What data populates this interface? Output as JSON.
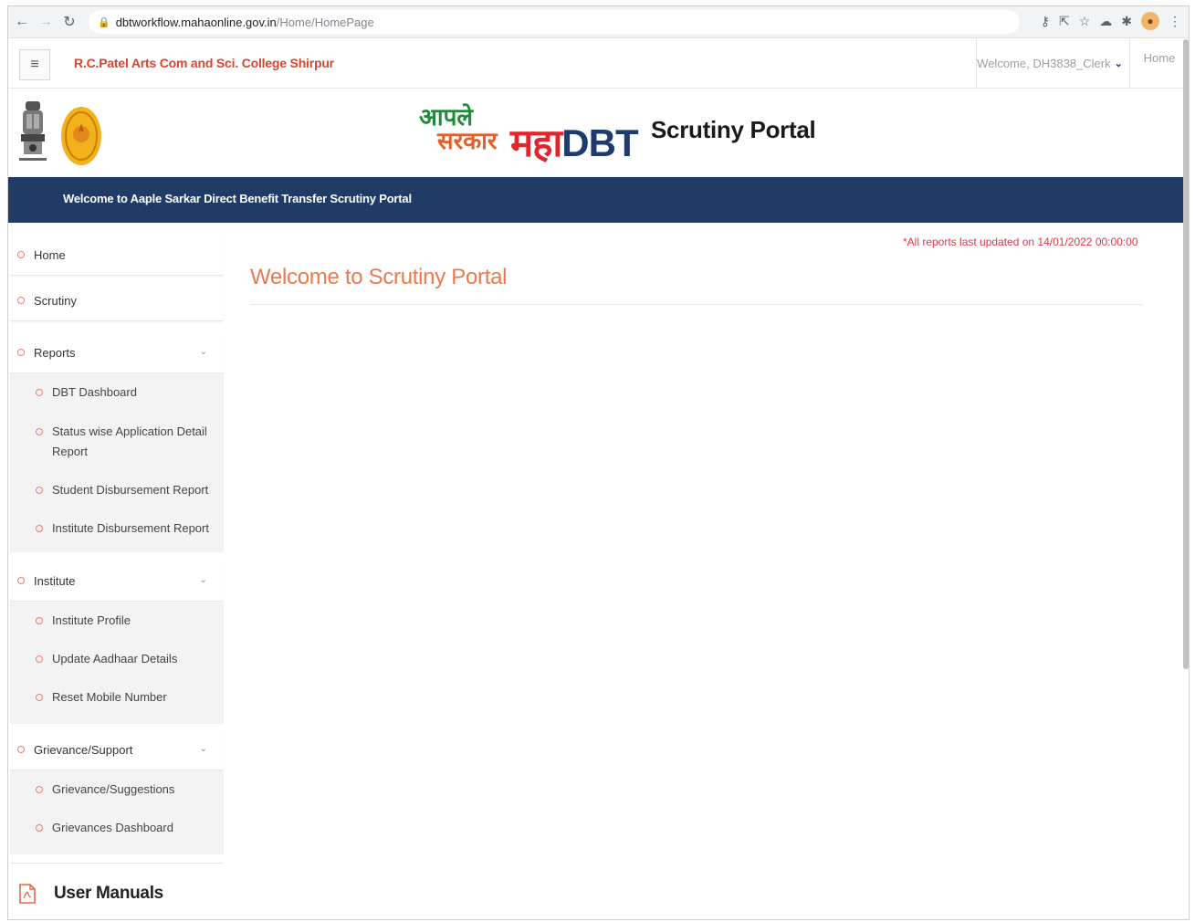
{
  "browser": {
    "url_host": "dbtworkflow.mahaonline.gov.in",
    "url_path": "/Home/HomePage"
  },
  "header": {
    "college_name": "R.C.Patel Arts Com and Sci. College Shirpur",
    "welcome_user": "Welcome, DH3838_Clerk",
    "home_link": "Home"
  },
  "logos": {
    "aaple_line1": "आपले",
    "aaple_line2": "सरकार",
    "maha_prefix": "महा",
    "maha_dbt": "DBT",
    "portal_title": "Scrutiny Portal"
  },
  "banner": {
    "text": "Welcome to Aaple Sarkar Direct Benefit Transfer Scrutiny Portal"
  },
  "sidebar": {
    "home": "Home",
    "scrutiny": "Scrutiny",
    "reports": {
      "label": "Reports",
      "items": [
        "DBT Dashboard",
        "Status wise Application Detail Report",
        "Student Disbursement Report",
        "Institute Disbursement Report"
      ]
    },
    "institute": {
      "label": "Institute",
      "items": [
        "Institute Profile",
        "Update Aadhaar Details",
        "Reset Mobile Number"
      ]
    },
    "grievance": {
      "label": "Grievance/Support",
      "items": [
        "Grievance/Suggestions",
        "Grievances Dashboard"
      ]
    },
    "user_manuals": "User Manuals"
  },
  "main": {
    "updated_note": "*All reports last updated on 14/01/2022 00:00:00",
    "title": "Welcome to Scrutiny Portal"
  },
  "colors": {
    "banner": "#1f3b66",
    "accent_orange": "#e97a4f",
    "college_red": "#d9442c",
    "note_red": "#e8344a"
  }
}
